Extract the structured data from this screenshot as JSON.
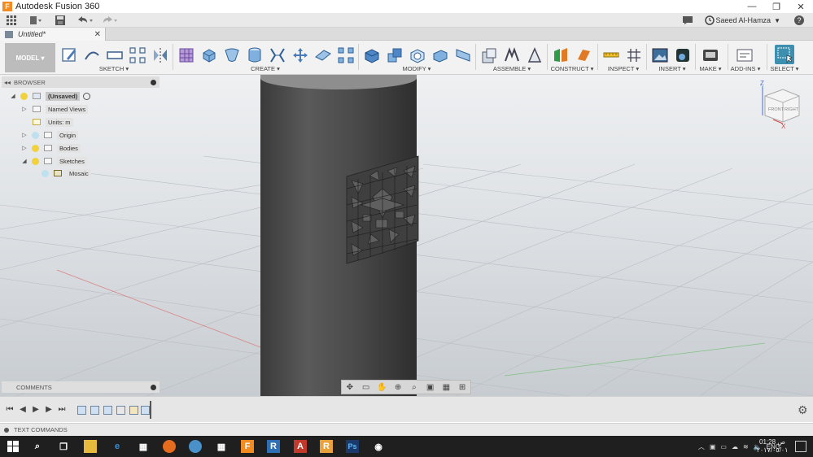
{
  "window": {
    "title": "Autodesk Fusion 360",
    "logo_letter": "F"
  },
  "quickbar": {
    "user": "Saeed Al-Hamza",
    "help": "?"
  },
  "document": {
    "tab_title": "Untitled*",
    "close": "✕"
  },
  "toolbar": {
    "workspace": "MODEL ▾",
    "groups": {
      "sketch": "SKETCH ▾",
      "create": "CREATE ▾",
      "modify": "MODIFY ▾",
      "assemble": "ASSEMBLE ▾",
      "construct": "CONSTRUCT ▾",
      "inspect": "INSPECT ▾",
      "insert": "INSERT ▾",
      "make": "MAKE ▾",
      "addins": "ADD-INS ▾",
      "select": "SELECT ▾"
    },
    "colors": {
      "accent": "#3b7fb6",
      "select_active": "#3d8fb0",
      "construct_green": "#2f9a48",
      "construct_orange": "#e07a24"
    }
  },
  "browser": {
    "title": "BROWSER",
    "items": [
      {
        "label": "(Unsaved)"
      },
      {
        "label": "Named Views"
      },
      {
        "label": "Units: m"
      },
      {
        "label": "Origin"
      },
      {
        "label": "Bodies"
      },
      {
        "label": "Sketches"
      },
      {
        "label": "Mosaic"
      }
    ]
  },
  "viewcube": {
    "face_front": "FRONT",
    "face_right": "RIGHT",
    "axis_z": "Z",
    "axis_x": "X"
  },
  "comments": {
    "title": "COMMENTS"
  },
  "textcommands": {
    "title": "TEXT COMMANDS"
  },
  "taskbar": {
    "lang": "ENG",
    "time": "01:28 ص",
    "date": "٢٠١٧/٠٥/٠١"
  },
  "viewport": {
    "background_top": "#eef0f2",
    "background_bottom": "#c7ccd1",
    "body_color": "#4a4a4a"
  }
}
